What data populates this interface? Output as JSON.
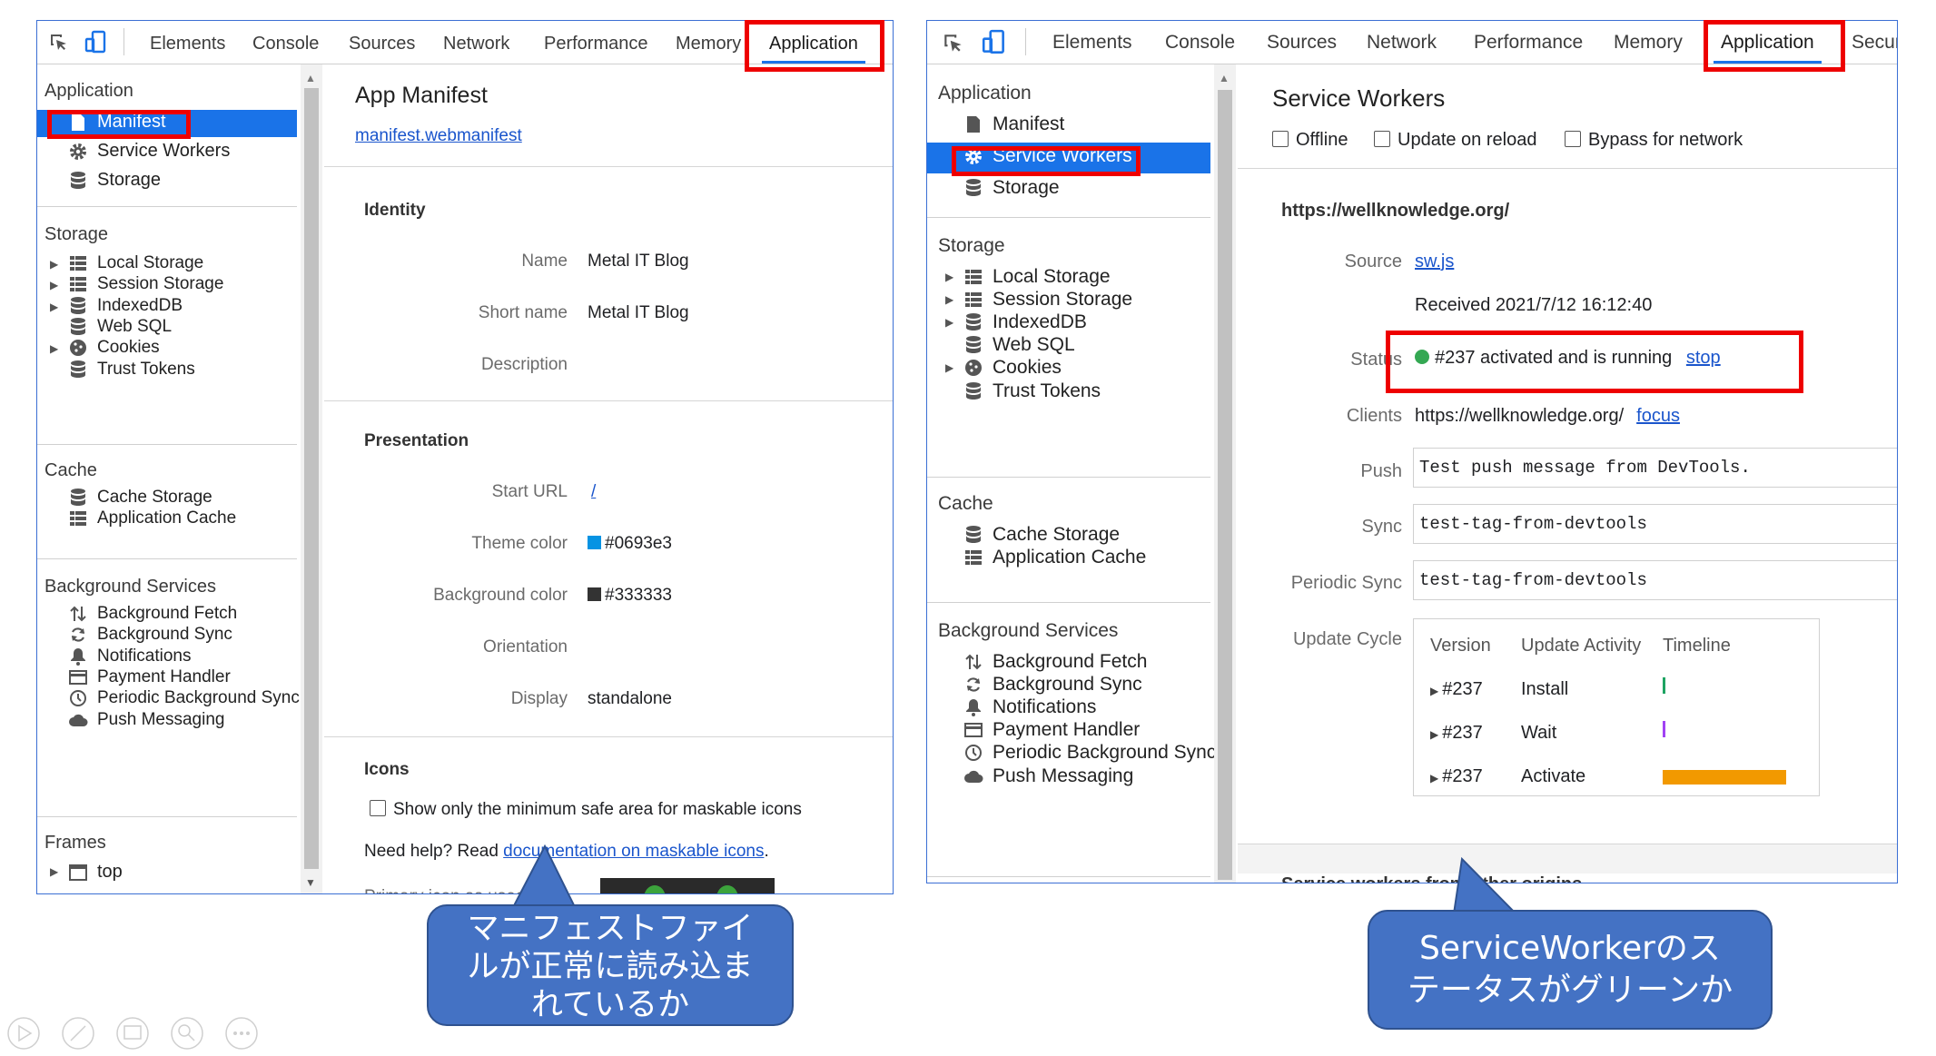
{
  "devtools_tabs": [
    "Elements",
    "Console",
    "Sources",
    "Network",
    "Performance",
    "Memory",
    "Application"
  ],
  "right_extra_tab": "Securi",
  "left": {
    "sidebar": {
      "application_header": "Application",
      "app_items": [
        "Manifest",
        "Service Workers",
        "Storage"
      ],
      "storage_header": "Storage",
      "storage_items": [
        "Local Storage",
        "Session Storage",
        "IndexedDB",
        "Web SQL",
        "Cookies",
        "Trust Tokens"
      ],
      "cache_header": "Cache",
      "cache_items": [
        "Cache Storage",
        "Application Cache"
      ],
      "bg_header": "Background Services",
      "bg_items": [
        "Background Fetch",
        "Background Sync",
        "Notifications",
        "Payment Handler",
        "Periodic Background Sync",
        "Push Messaging"
      ],
      "frames_header": "Frames",
      "frames_items": [
        "top"
      ]
    },
    "main": {
      "title": "App Manifest",
      "manifest_link": "manifest.webmanifest",
      "identity_header": "Identity",
      "name_label": "Name",
      "name_value": "Metal IT Blog",
      "short_name_label": "Short name",
      "short_name_value": "Metal IT Blog",
      "description_label": "Description",
      "presentation_header": "Presentation",
      "start_url_label": "Start URL",
      "start_url_value": "/",
      "theme_color_label": "Theme color",
      "theme_color_value": "#0693e3",
      "bg_color_label": "Background color",
      "bg_color_value": "#333333",
      "orientation_label": "Orientation",
      "display_label": "Display",
      "display_value": "standalone",
      "icons_header": "Icons",
      "maskable_checkbox": "Show only the minimum safe area for maskable icons",
      "help_prefix": "Need help? Read ",
      "help_link": "documentation on maskable icons",
      "help_suffix": ".",
      "primary_icon_label": "Primary icon as used by"
    }
  },
  "right": {
    "sidebar": {
      "application_header": "Application",
      "app_items": [
        "Manifest",
        "Service Workers",
        "Storage"
      ],
      "storage_header": "Storage",
      "storage_items": [
        "Local Storage",
        "Session Storage",
        "IndexedDB",
        "Web SQL",
        "Cookies",
        "Trust Tokens"
      ],
      "cache_header": "Cache",
      "cache_items": [
        "Cache Storage",
        "Application Cache"
      ],
      "bg_header": "Background Services",
      "bg_items": [
        "Background Fetch",
        "Background Sync",
        "Notifications",
        "Payment Handler",
        "Periodic Background Sync",
        "Push Messaging"
      ]
    },
    "main": {
      "title": "Service Workers",
      "offline": "Offline",
      "update_on_reload": "Update on reload",
      "bypass": "Bypass for network",
      "origin": "https://wellknowledge.org/",
      "source_label": "Source",
      "source_link": "sw.js",
      "received": "Received 2021/7/12 16:12:40",
      "status_label": "Status",
      "status_text": "#237 activated and is running",
      "stop_link": "stop",
      "clients_label": "Clients",
      "clients_value": "https://wellknowledge.org/",
      "focus_link": "focus",
      "push_label": "Push",
      "push_value": "Test push message from DevTools.",
      "sync_label": "Sync",
      "sync_value": "test-tag-from-devtools",
      "periodic_label": "Periodic Sync",
      "periodic_value": "test-tag-from-devtools",
      "update_cycle_label": "Update Cycle",
      "cycle_headers": [
        "Version",
        "Update Activity",
        "Timeline"
      ],
      "cycle_rows": [
        {
          "version": "#237",
          "activity": "Install"
        },
        {
          "version": "#237",
          "activity": "Wait"
        },
        {
          "version": "#237",
          "activity": "Activate"
        }
      ],
      "other_origins": "Service workers from other origins"
    }
  },
  "callouts": {
    "left": [
      "マニフェストファイ",
      "ルが正常に読み込ま",
      "れているか"
    ],
    "right": [
      "ServiceWorkerのス",
      "テータスがグリーンか"
    ]
  },
  "colors": {
    "accent": "#1a73e8",
    "highlight": "#e00000",
    "callout": "#4472c4",
    "status_green": "#34a853",
    "timeline_install": "#1ea362",
    "timeline_wait": "#a142f4",
    "timeline_activate": "#f29900"
  }
}
